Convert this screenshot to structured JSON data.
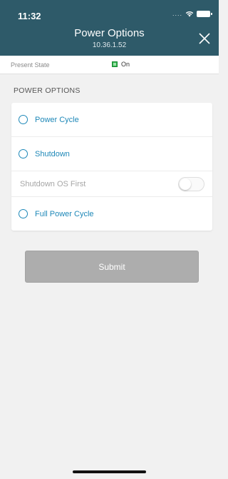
{
  "status_bar": {
    "time": "11:32",
    "signal": "....",
    "wifi_icon": "wifi-icon",
    "battery_icon": "battery-icon"
  },
  "header": {
    "title": "Power Options",
    "subtitle": "10.36.1.52",
    "close_icon": "close-icon",
    "background_color": "#2e5a69"
  },
  "present_state": {
    "label": "Present State",
    "value": "On",
    "status_color": "#2db34a"
  },
  "section": {
    "title": "POWER OPTIONS"
  },
  "options": [
    {
      "label": "Power Cycle",
      "type": "radio",
      "selected": false
    },
    {
      "label": "Shutdown",
      "type": "radio",
      "selected": false
    },
    {
      "label": "Shutdown OS First",
      "type": "toggle",
      "enabled": false,
      "on": false
    },
    {
      "label": "Full Power Cycle",
      "type": "radio",
      "selected": false
    }
  ],
  "submit": {
    "label": "Submit",
    "enabled": false
  },
  "accent_color": "#1e88b8"
}
